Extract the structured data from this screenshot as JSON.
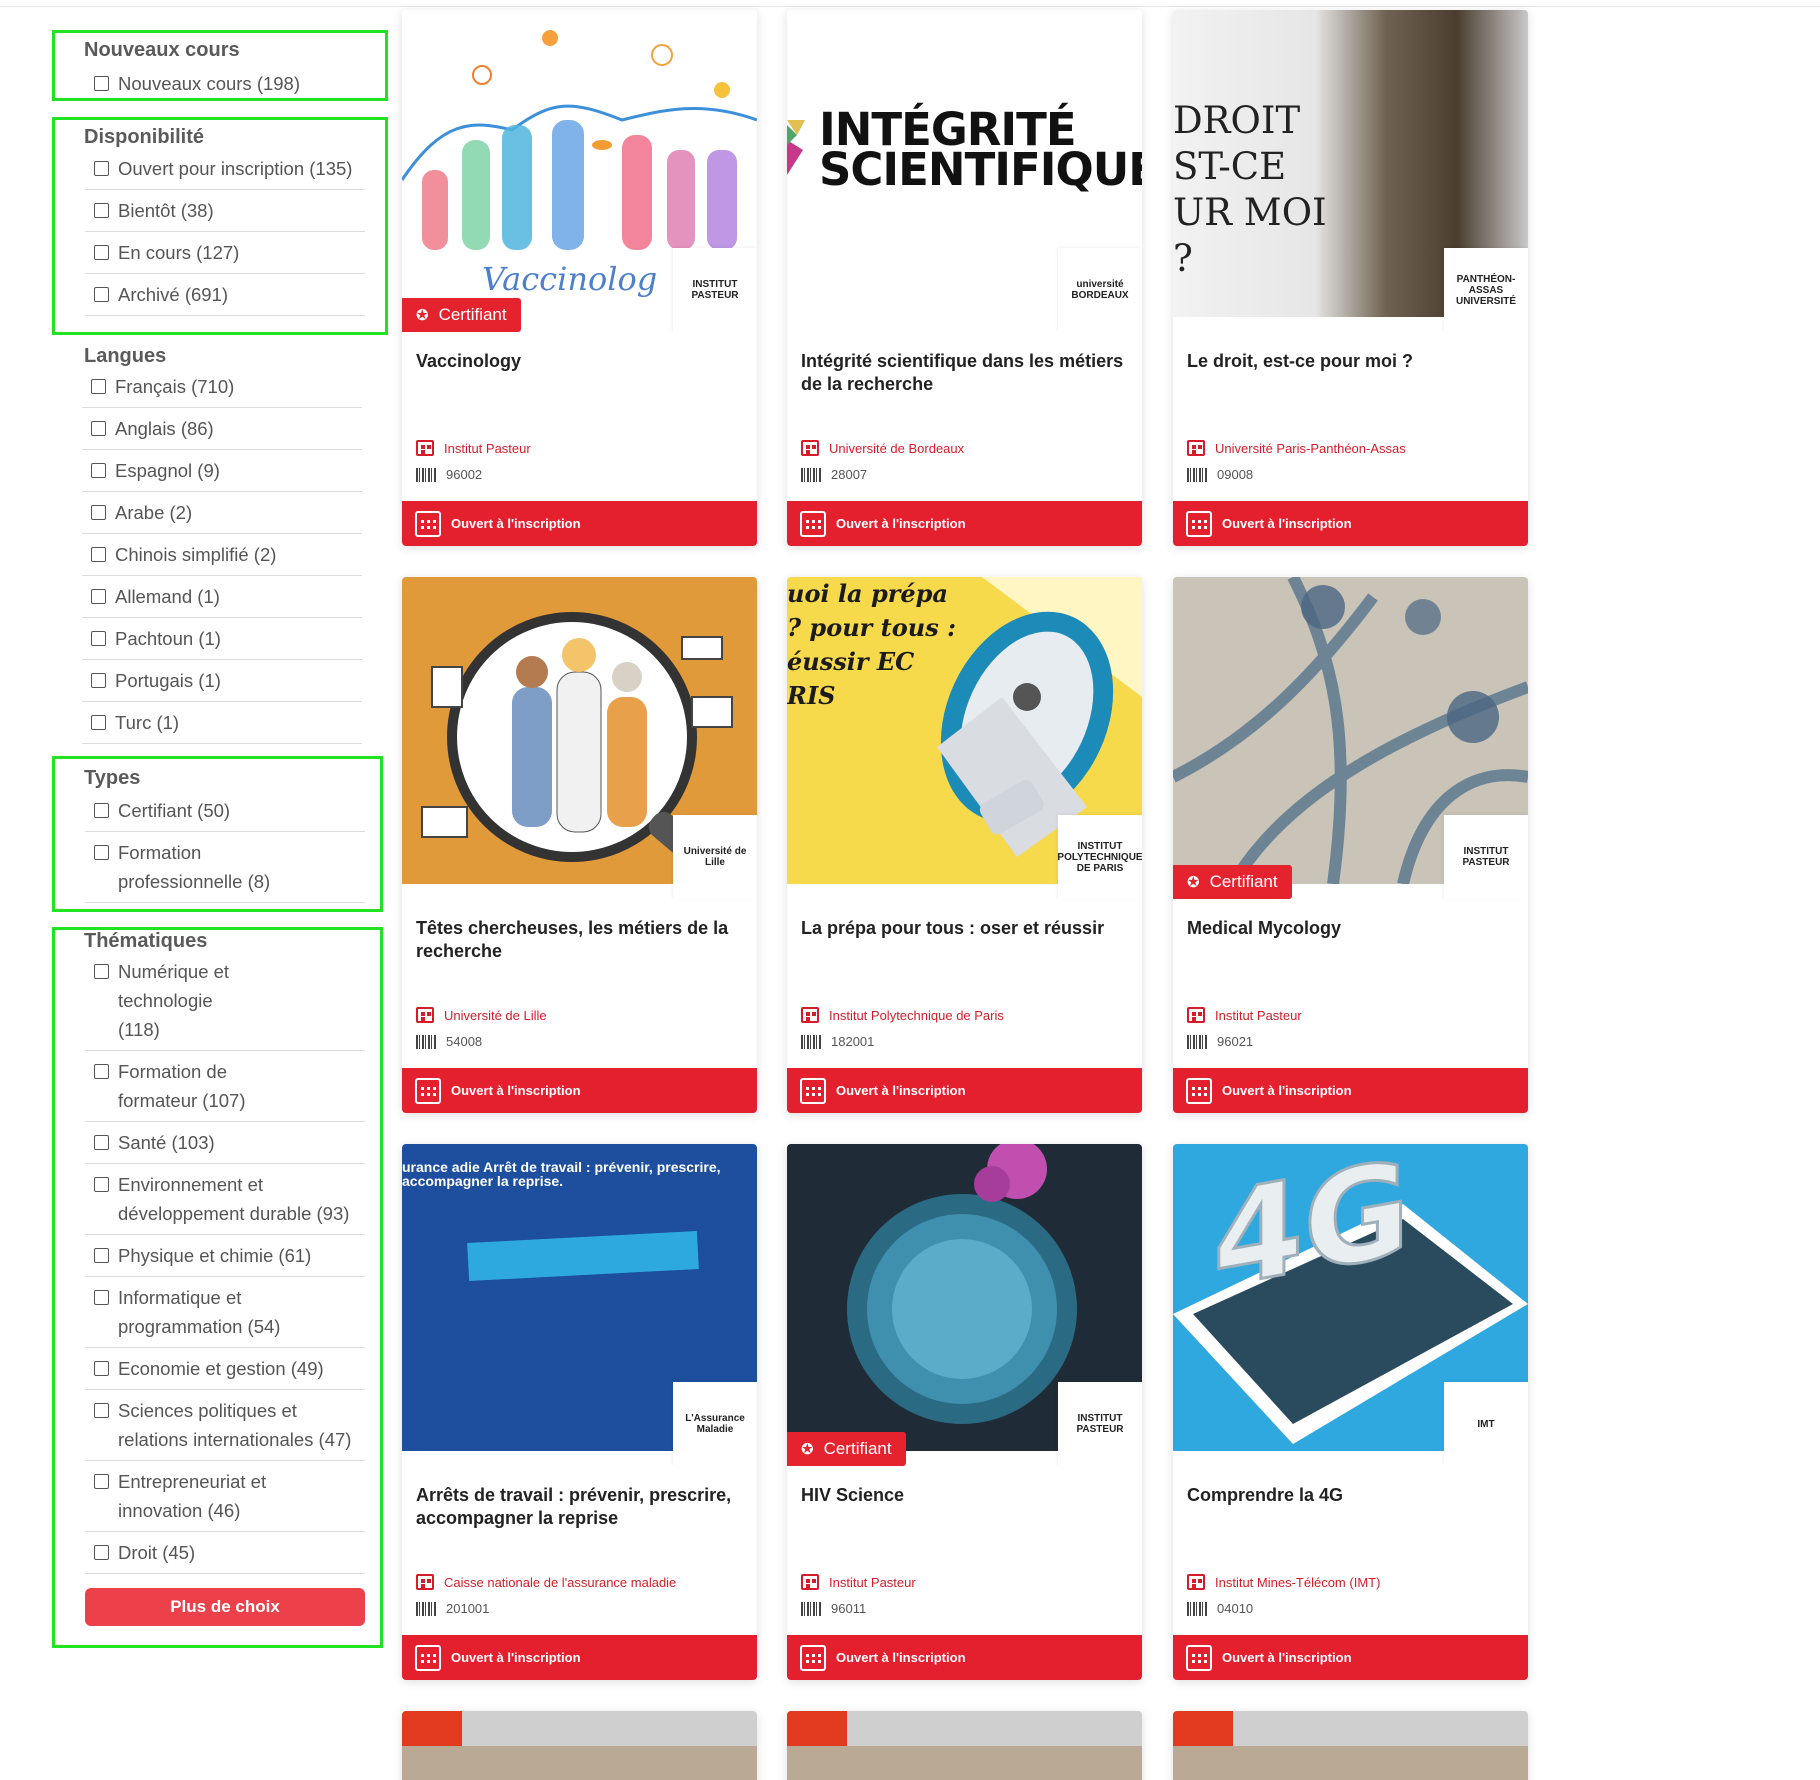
{
  "filters": {
    "new_courses": {
      "title": "Nouveaux cours",
      "items": [
        "Nouveaux cours (198)"
      ]
    },
    "availability": {
      "title": "Disponibilité",
      "items": [
        "Ouvert pour inscription (135)",
        "Bientôt (38)",
        "En cours (127)",
        "Archivé (691)"
      ]
    },
    "languages": {
      "title": "Langues",
      "items": [
        "Français (710)",
        "Anglais (86)",
        "Espagnol (9)",
        "Arabe (2)",
        "Chinois simplifié (2)",
        "Allemand (1)",
        "Pachtoun (1)",
        "Portugais (1)",
        "Turc (1)"
      ]
    },
    "types": {
      "title": "Types",
      "items": [
        "Certifiant (50)",
        "Formation professionnelle (8)"
      ]
    },
    "themes": {
      "title": "Thématiques",
      "items": [
        "Numérique et technologie (118)",
        "Formation de formateur (107)",
        "Santé (103)",
        "Environnement et développement durable (93)",
        "Physique et chimie (61)",
        "Informatique et programmation (54)",
        "Economie et gestion (49)",
        "Sciences politiques et relations internationales (47)",
        "Entrepreneuriat et innovation (46)",
        "Droit (45)"
      ],
      "more_label": "Plus de choix"
    }
  },
  "badge_label": "Certifiant",
  "footer_label": "Ouvert à l'inscription",
  "cards": [
    {
      "title": "Vaccinology",
      "org": "Institut Pasteur",
      "code": "96002",
      "cert": true,
      "logo": "INSTITUT PASTEUR",
      "img_text": "Vaccinolog",
      "bg": "#ffffff"
    },
    {
      "title": "Intégrité scientifique dans les métiers de la recherche",
      "org": "Université de Bordeaux",
      "code": "28007",
      "cert": false,
      "logo": "université BORDEAUX",
      "img_text": "INTÉGRITÉ SCIENTIFIQUE",
      "bg": "#ffffff"
    },
    {
      "title": "Le droit, est-ce pour moi ?",
      "org": "Université Paris-Panthéon-Assas",
      "code": "09008",
      "cert": false,
      "logo": "PANTHÉON-ASSAS UNIVERSITÉ",
      "img_text": "DROIT ST-CE UR MOI ?",
      "bg": "#d8d8d8"
    },
    {
      "title": "Têtes chercheuses, les métiers de la recherche",
      "org": "Université de Lille",
      "code": "54008",
      "cert": false,
      "logo": "Université de Lille",
      "img_text": "",
      "bg": "#e09a3a"
    },
    {
      "title": "La prépa pour tous : oser et réussir",
      "org": "Institut Polytechnique de Paris",
      "code": "182001",
      "cert": false,
      "logo": "INSTITUT POLYTECHNIQUE DE PARIS",
      "img_text": "uoi la prépa ? pour tous : éussir EC RIS",
      "bg": "#f7d94c"
    },
    {
      "title": "Medical Mycology",
      "org": "Institut Pasteur",
      "code": "96021",
      "cert": true,
      "logo": "INSTITUT PASTEUR",
      "img_text": "",
      "bg": "#c9c3b8"
    },
    {
      "title": "Arrêts de travail : prévenir, prescrire, accompagner la reprise",
      "org": "Caisse nationale de l'assurance maladie",
      "code": "201001",
      "cert": false,
      "logo": "L'Assurance Maladie",
      "img_text": "urance adie Arrêt de travail : prévenir, prescrire, accompagner la reprise.",
      "bg": "#1d4f9e"
    },
    {
      "title": "HIV Science",
      "org": "Institut Pasteur",
      "code": "96011",
      "cert": true,
      "logo": "INSTITUT PASTEUR",
      "img_text": "",
      "bg": "#1f2b36"
    },
    {
      "title": "Comprendre la 4G",
      "org": "Institut Mines-Télécom (IMT)",
      "code": "04010",
      "cert": false,
      "logo": "IMT",
      "img_text": "4G",
      "bg": "#2fa8e0"
    }
  ],
  "colors": {
    "accent": "#e41f2e",
    "filter_box": "#22e322",
    "more_button": "#ec414b"
  }
}
